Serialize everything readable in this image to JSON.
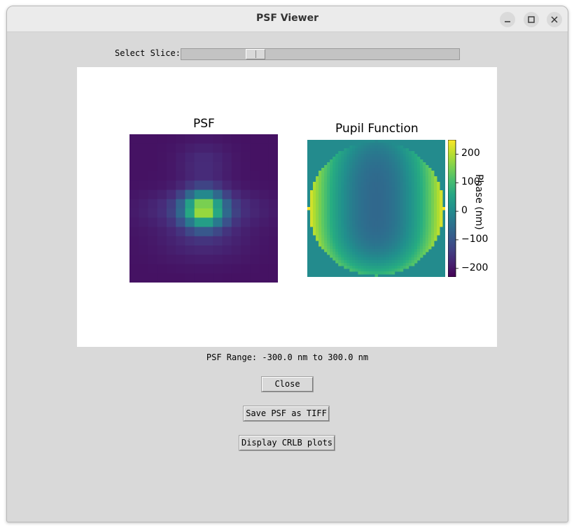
{
  "window": {
    "title": "PSF Viewer",
    "controls": {
      "minimize": "minimize-icon",
      "maximize": "maximize-icon",
      "close": "close-icon"
    }
  },
  "slider": {
    "label": "Select Slice:",
    "position_fraction": 0.25
  },
  "psf_plot": {
    "title": "PSF",
    "colormap": "viridis"
  },
  "pupil_plot": {
    "title": "Pupil Function",
    "colormap": "viridis",
    "colorbar": {
      "ticks": [
        "200",
        "100",
        "0",
        "−100",
        "−200"
      ],
      "tick_values": [
        200,
        100,
        0,
        -100,
        -200
      ],
      "range": [
        -230,
        250
      ],
      "label": "Phase (nm)"
    }
  },
  "range_text": "PSF Range: -300.0 nm to 300.0 nm",
  "buttons": {
    "close": "Close",
    "save": "Save PSF as TIFF",
    "crlb": "Display CRLB plots"
  }
}
